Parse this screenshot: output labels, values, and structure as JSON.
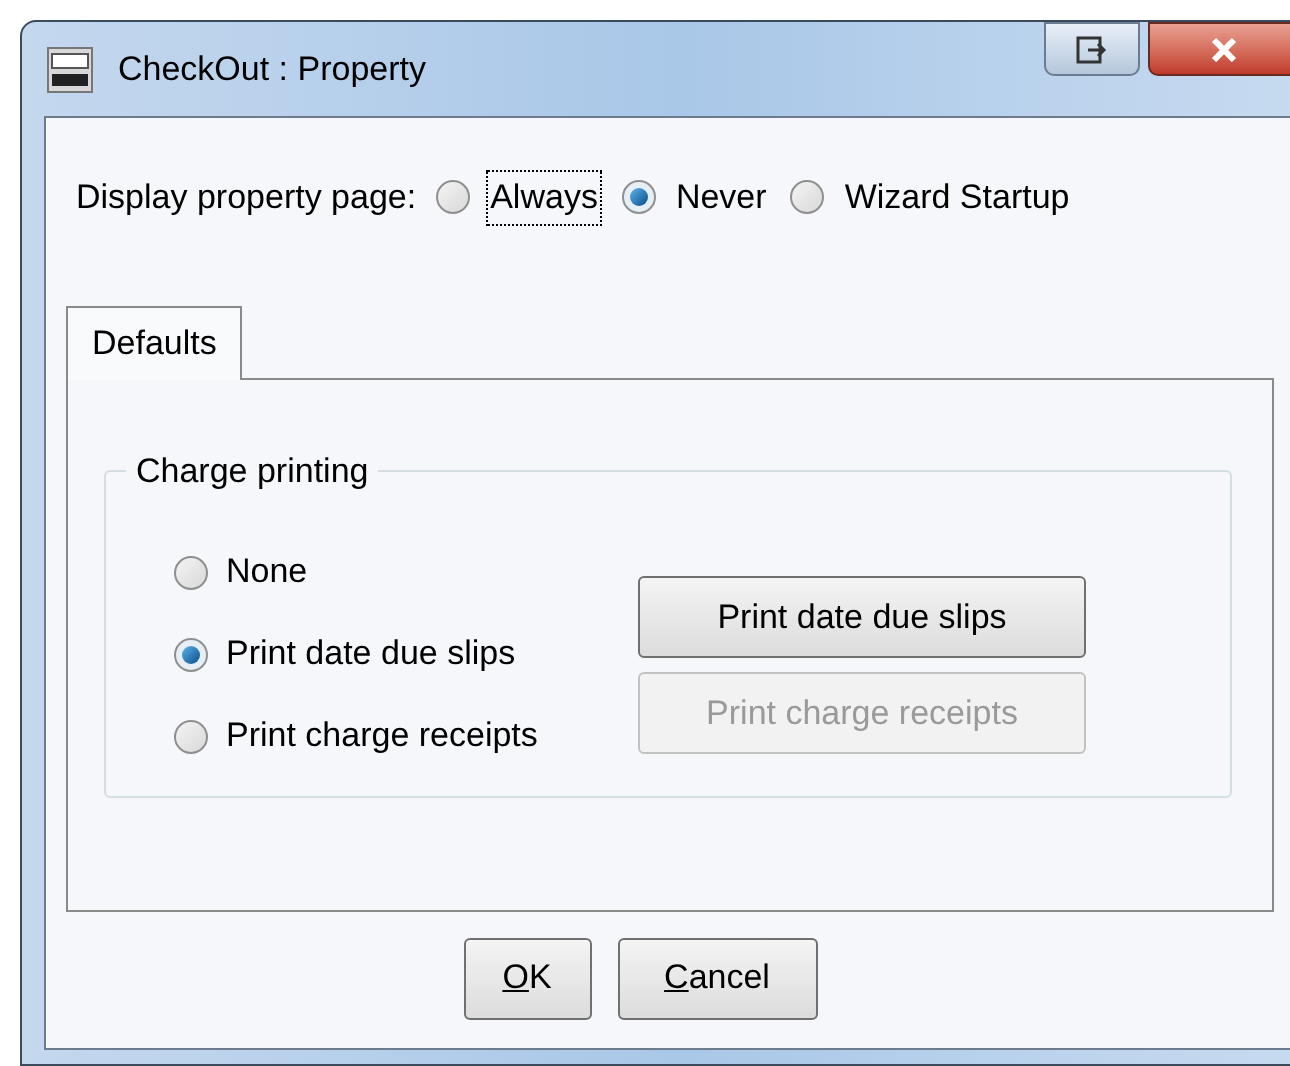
{
  "window": {
    "title": "CheckOut : Property"
  },
  "display_option": {
    "label": "Display property page:",
    "options": [
      {
        "label": "Always",
        "selected": false,
        "focused": true
      },
      {
        "label": "Never",
        "selected": true,
        "focused": false
      },
      {
        "label": "Wizard Startup",
        "selected": false,
        "focused": false
      }
    ]
  },
  "tabs": [
    {
      "label": "Defaults",
      "selected": true
    }
  ],
  "charge_printing": {
    "title": "Charge printing",
    "options": [
      {
        "label": "None",
        "selected": false
      },
      {
        "label": "Print date due slips",
        "selected": true
      },
      {
        "label": "Print charge receipts",
        "selected": false
      }
    ],
    "buttons": [
      {
        "label": "Print date due slips",
        "disabled": false
      },
      {
        "label": "Print charge receipts",
        "disabled": true
      }
    ]
  },
  "buttons": [
    {
      "label": "OK",
      "underline_first": true
    },
    {
      "label": "Cancel",
      "underline_first": true
    }
  ]
}
